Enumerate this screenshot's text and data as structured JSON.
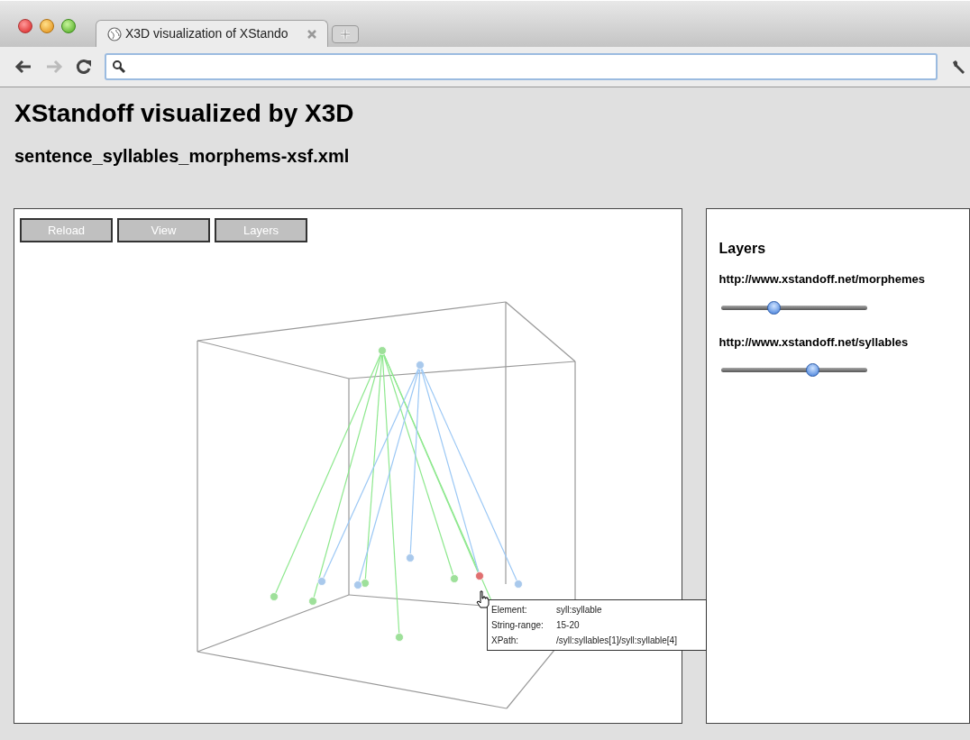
{
  "browser": {
    "tab_title": "X3D visualization of XStando"
  },
  "page": {
    "title": "XStandoff visualized by X3D",
    "subtitle": "sentence_syllables_morphems-xsf.xml"
  },
  "viewer": {
    "buttons": [
      "Reload",
      "View",
      "Layers"
    ],
    "tooltip": [
      {
        "label": "Element:",
        "value": "syll:syllable"
      },
      {
        "label": "String-range:",
        "value": "15-20"
      },
      {
        "label": "XPath:",
        "value": "/syll:syllables[1]/syll:syllable[4]"
      }
    ]
  },
  "layers_panel": {
    "title": "Layers",
    "layers": [
      {
        "url": "http://www.xstandoff.net/morphemes",
        "level": 0.35
      },
      {
        "url": "http://www.xstandoff.net/syllables",
        "level": 0.64
      }
    ]
  }
}
